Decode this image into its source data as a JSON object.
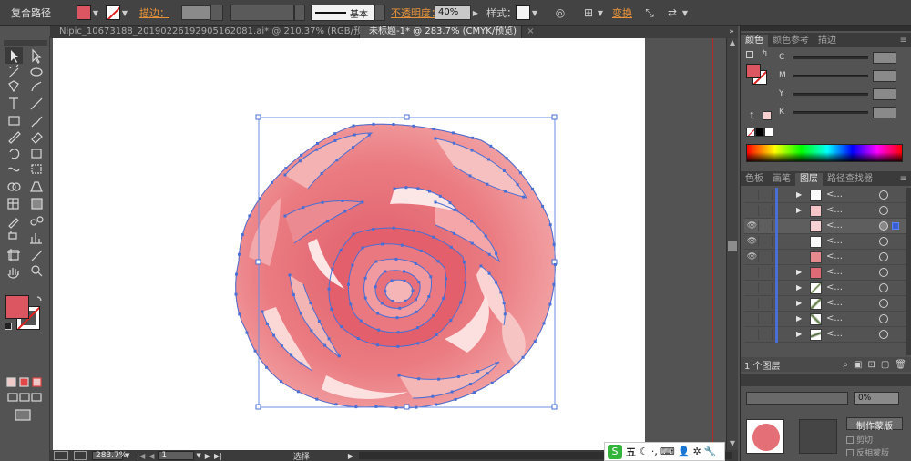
{
  "control_bar": {
    "selection_type": "复合路径",
    "stroke_label": "描边：",
    "stroke_profile": "基本",
    "opacity_label": "不透明度：",
    "opacity_value": "40%",
    "style_label": "样式：",
    "transform_label": "变换"
  },
  "doc_tabs": [
    {
      "label": "Nipic_10673188_20190226192905162081.ai* @ 210.37% (RGB/预览)",
      "close": "×",
      "active": false
    },
    {
      "label": "未标题-1* @ 283.7% (CMYK/预览)",
      "close": "×",
      "active": true
    }
  ],
  "status_bar": {
    "zoom": "283.7%",
    "artboard_num": "1",
    "tool_name": "选择"
  },
  "color_panel": {
    "tabs": [
      "颜色",
      "颜色参考",
      "描边"
    ],
    "channels": [
      "C",
      "M",
      "Y",
      "K"
    ]
  },
  "layers_panel": {
    "tabs": [
      "色板",
      "画笔",
      "图层",
      "路径查找器"
    ],
    "row_label": "<...",
    "layer_count": "1 个图层"
  },
  "transparency_panel": {
    "opacity": "0%",
    "make_mask_button": "制作蒙版",
    "clip_label": "剪切",
    "invert_label": "反相蒙版"
  },
  "ime": {
    "label": "五"
  },
  "colors": {
    "fill": "#dc5662",
    "rose_main": "#ea7b81",
    "selection": "#4a6fd4",
    "panel_bg": "#535353",
    "accent_orange": "#e8933a"
  }
}
